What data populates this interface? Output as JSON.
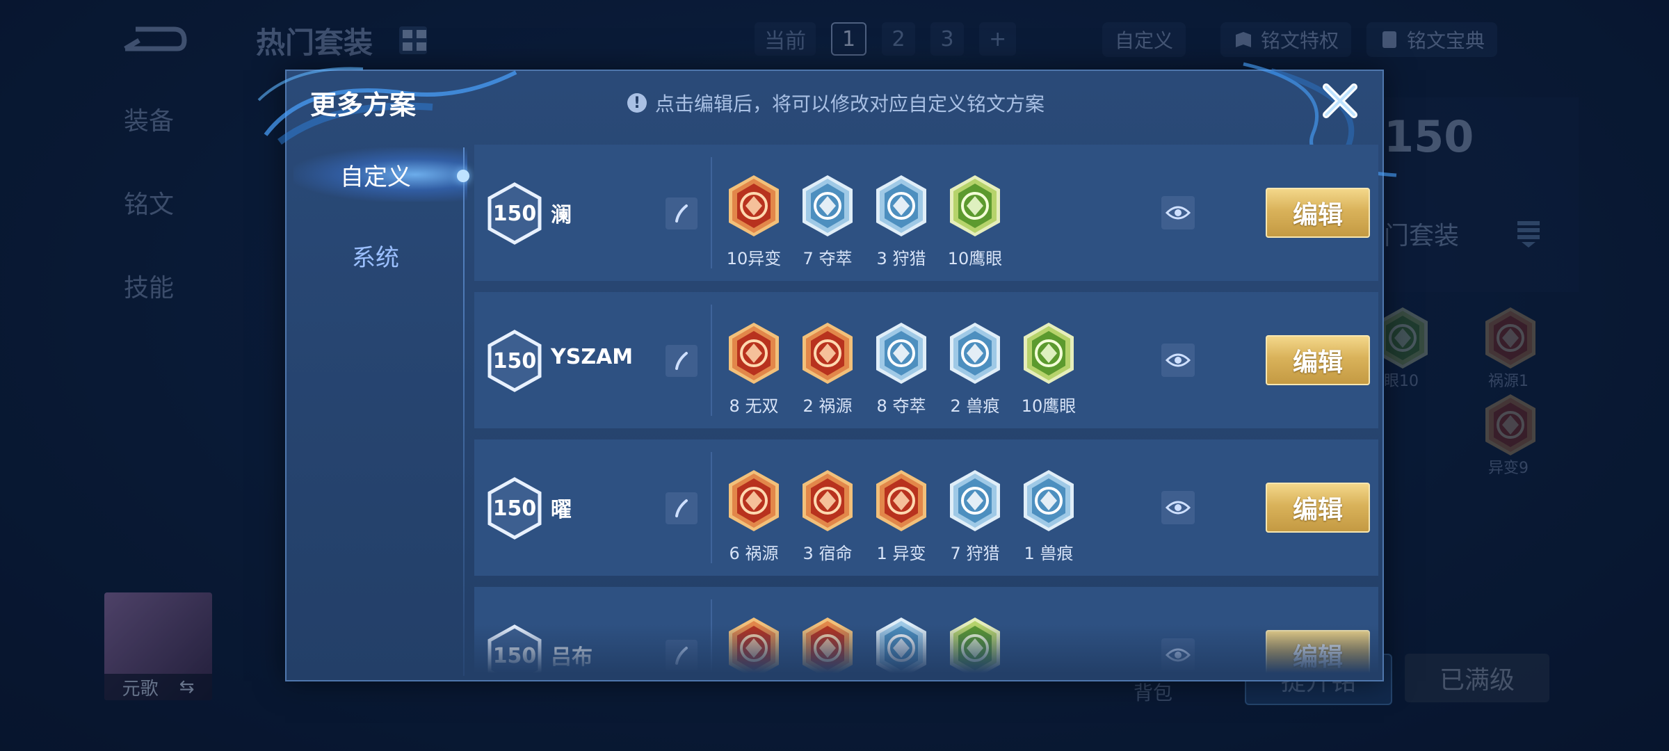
{
  "background": {
    "title": "热门套装",
    "tabs": [
      "当前",
      "1",
      "2",
      "3",
      "+"
    ],
    "custom_label": "自定义",
    "privilege_label": "铭文特权",
    "codex_label": "铭文宝典",
    "side_items": [
      "装备",
      "铭文",
      "技能"
    ],
    "level_badge": "150",
    "hot_set_label": "门套装",
    "runes": [
      {
        "label": "眼10",
        "kind": "green"
      },
      {
        "label": "祸源1",
        "kind": "red"
      },
      {
        "label": "异变9",
        "kind": "red"
      }
    ],
    "hero_name": "元歌",
    "bag_label": "背包",
    "upgrade_label": "提升铭",
    "maxed_label": "已满级"
  },
  "modal": {
    "title": "更多方案",
    "hint": "点击编辑后，将可以修改对应自定义铭文方案",
    "sidebar": {
      "tabs": [
        {
          "label": "自定义",
          "active": true
        },
        {
          "label": "系统",
          "active": false
        }
      ]
    },
    "edit_label": "编辑",
    "plans": [
      {
        "level": "150",
        "name": "澜",
        "runes": [
          {
            "label": "10异变",
            "kind": "red"
          },
          {
            "label": "7 夺萃",
            "kind": "blue"
          },
          {
            "label": "3 狩猎",
            "kind": "blue"
          },
          {
            "label": "10鹰眼",
            "kind": "green"
          }
        ]
      },
      {
        "level": "150",
        "name": "YSZAM",
        "runes": [
          {
            "label": "8 无双",
            "kind": "red"
          },
          {
            "label": "2 祸源",
            "kind": "red"
          },
          {
            "label": "8 夺萃",
            "kind": "blue"
          },
          {
            "label": "2 兽痕",
            "kind": "blue"
          },
          {
            "label": "10鹰眼",
            "kind": "green"
          }
        ]
      },
      {
        "level": "150",
        "name": "曜",
        "runes": [
          {
            "label": "6 祸源",
            "kind": "red"
          },
          {
            "label": "3 宿命",
            "kind": "red"
          },
          {
            "label": "1 异变",
            "kind": "red"
          },
          {
            "label": "7 狩猎",
            "kind": "blue"
          },
          {
            "label": "1 兽痕",
            "kind": "blue"
          }
        ]
      },
      {
        "level": "150",
        "name": "吕布",
        "runes": [
          {
            "label": "",
            "kind": "red"
          },
          {
            "label": "",
            "kind": "red"
          },
          {
            "label": "",
            "kind": "blue"
          },
          {
            "label": "",
            "kind": "green"
          }
        ]
      }
    ]
  },
  "colors": {
    "accent_gold": "#d9b25a",
    "panel": "#233f68",
    "row": "#2e5182"
  }
}
